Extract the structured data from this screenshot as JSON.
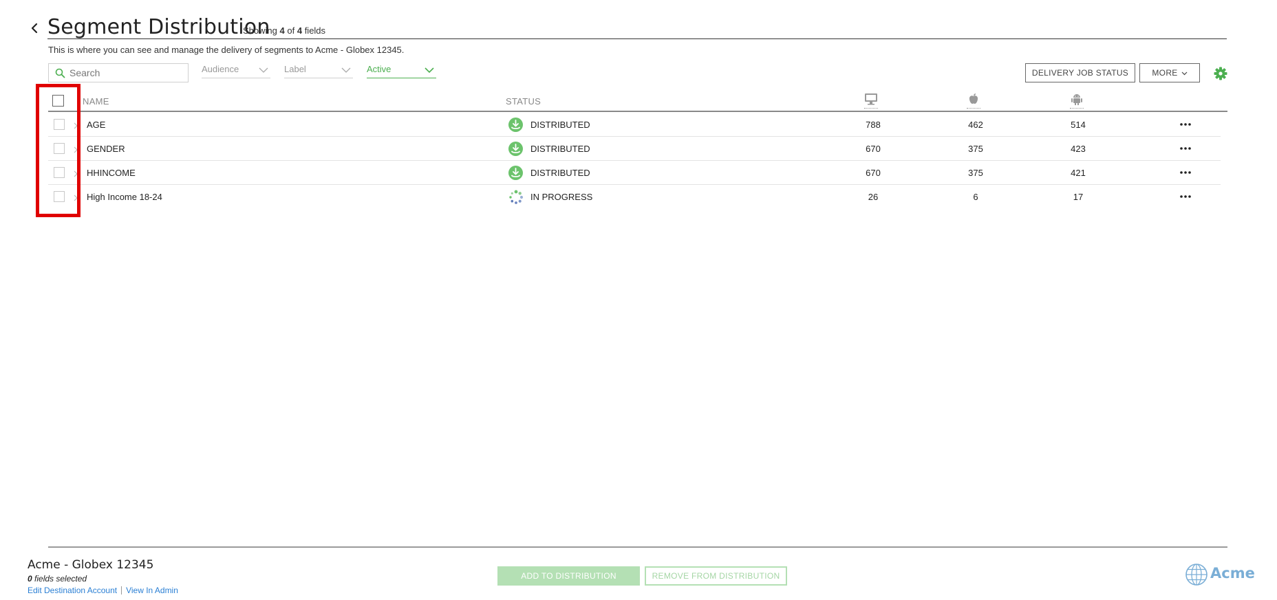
{
  "header": {
    "title": "Segment Distribution",
    "showing_prefix": "Showing",
    "showing_count": "4",
    "showing_of": "of",
    "showing_total": "4",
    "showing_suffix": "fields",
    "subtitle": "This is where you can see and manage the delivery of segments to Acme - Globex 12345."
  },
  "filters": {
    "search_placeholder": "Search",
    "audience": "Audience",
    "label": "Label",
    "status": "Active"
  },
  "toolbar": {
    "delivery_job_status": "DELIVERY JOB STATUS",
    "more": "MORE"
  },
  "table": {
    "columns": {
      "name": "NAME",
      "status": "STATUS",
      "desktop_icon": "desktop-icon",
      "apple_icon": "apple-icon",
      "android_icon": "android-icon"
    },
    "rows": [
      {
        "name": "AGE",
        "status": "DISTRIBUTED",
        "status_icon": "distributed-icon",
        "desktop": "788",
        "ios": "462",
        "android": "514"
      },
      {
        "name": "GENDER",
        "status": "DISTRIBUTED",
        "status_icon": "distributed-icon",
        "desktop": "670",
        "ios": "375",
        "android": "423"
      },
      {
        "name": "HHINCOME",
        "status": "DISTRIBUTED",
        "status_icon": "distributed-icon",
        "desktop": "670",
        "ios": "375",
        "android": "421"
      },
      {
        "name": "High Income 18-24",
        "status": "IN PROGRESS",
        "status_icon": "in-progress-spinner-icon",
        "desktop": "26",
        "ios": "6",
        "android": "17"
      }
    ]
  },
  "footer": {
    "account_name": "Acme - Globex 12345",
    "fields_selected_count": "0",
    "fields_selected_label": "fields selected",
    "edit_link": "Edit Destination Account",
    "admin_link": "View In Admin",
    "add_button": "ADD TO DISTRIBUTION",
    "remove_button": "REMOVE FROM DISTRIBUTION",
    "logo_text": "Acme"
  },
  "colors": {
    "accent_green": "#4caf50",
    "highlight_red": "#e00000",
    "link_blue": "#2a7fd4",
    "disabled_green": "#b4e0b4",
    "logo_blue": "#7aaed6"
  }
}
